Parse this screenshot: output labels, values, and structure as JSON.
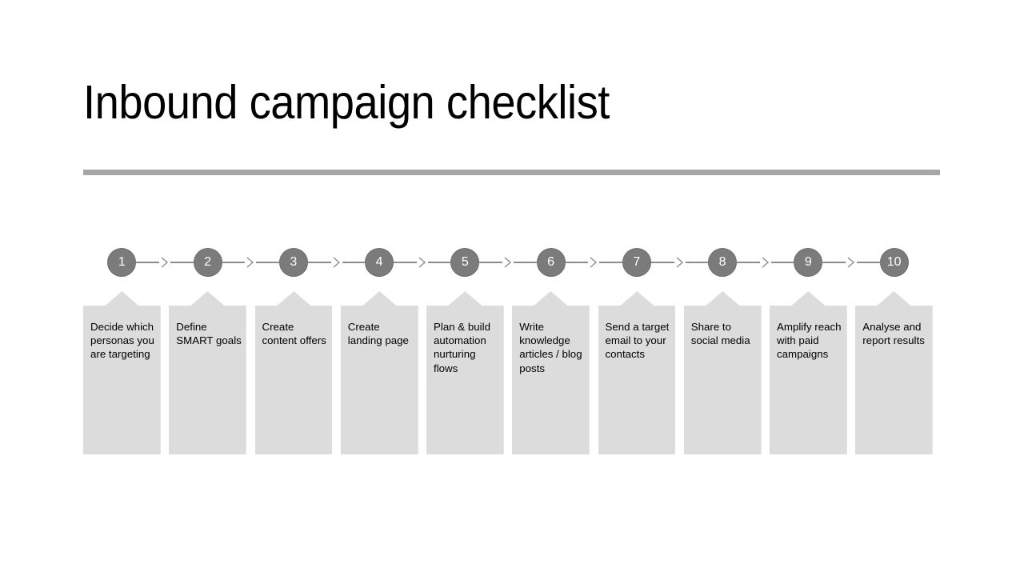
{
  "slide": {
    "title": "Inbound campaign checklist",
    "background_color": "#ffffff",
    "divider_color": "#a6a6a6"
  },
  "theme": {
    "node_fill": "#7b7b7b",
    "node_text": "#ffffff",
    "connector_color": "#8d8d8d",
    "card_fill": "#dcdcdd",
    "card_text": "#000000"
  },
  "process": {
    "step_count": 10,
    "steps": [
      {
        "number": "1",
        "text": "Decide which personas you are targeting"
      },
      {
        "number": "2",
        "text": "Define SMART goals"
      },
      {
        "number": "3",
        "text": "Create content offers"
      },
      {
        "number": "4",
        "text": "Create landing page"
      },
      {
        "number": "5",
        "text": "Plan & build automation nurturing flows"
      },
      {
        "number": "6",
        "text": "Write knowledge articles / blog posts"
      },
      {
        "number": "7",
        "text": "Send a target email to your contacts"
      },
      {
        "number": "8",
        "text": "Share to social media"
      },
      {
        "number": "9",
        "text": "Amplify reach with paid campaigns"
      },
      {
        "number": "10",
        "text": "Analyse and report results"
      }
    ]
  }
}
